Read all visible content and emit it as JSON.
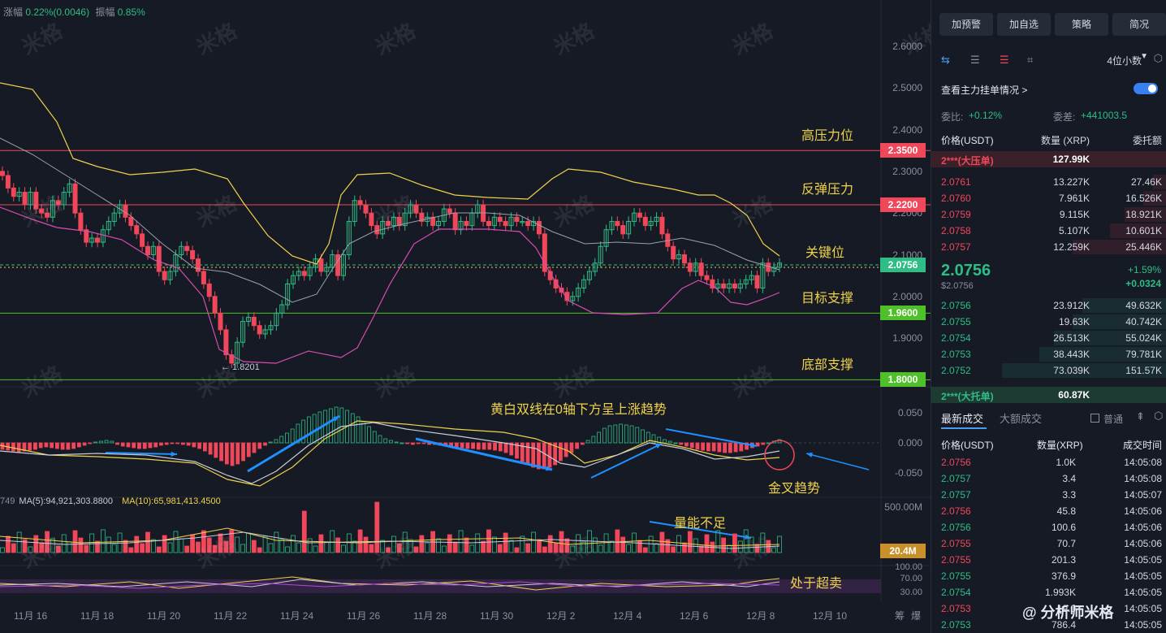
{
  "header": {
    "change_label": "涨幅",
    "change_value": "0.22%(0.0046)",
    "amp_label": "振幅",
    "amp_value": "0.85%"
  },
  "watermark": "米格",
  "price_axis": [
    "2.6000",
    "2.5000",
    "2.4000",
    "2.3000",
    "2.2000",
    "2.1000",
    "2.0000",
    "1.9000",
    "1.8000"
  ],
  "macd_axis": [
    "0.050",
    "0.000",
    "-0.050"
  ],
  "vol_axis": [
    "500.00M"
  ],
  "rsi_axis": [
    "100.00",
    "70.00",
    "30.00"
  ],
  "x_axis": [
    "11月 16",
    "11月 18",
    "11月 20",
    "11月 22",
    "11月 24",
    "11月 26",
    "11月 28",
    "11月 30",
    "12月 2",
    "12月 4",
    "12月 6",
    "12月 8",
    "12月 10"
  ],
  "x_extra": [
    "筹",
    "爆"
  ],
  "levels": [
    {
      "label": "高压力位",
      "price": "2.3500",
      "color": "#f0475a"
    },
    {
      "label": "反弹压力",
      "price": "2.2200",
      "color": "#f0475a"
    },
    {
      "label": "关键位",
      "price": "2.0756",
      "color": "#2ebd85"
    },
    {
      "label": "目标支撑",
      "price": "1.9600",
      "color": "#4fbf2a"
    },
    {
      "label": "底部支撑",
      "price": "1.8000",
      "color": "#4fbf2a"
    }
  ],
  "low_marker": "← 1.8201",
  "annotations": {
    "macd_title": "黄白双线在0轴下方呈上涨趋势",
    "golden_cross": "金叉趋势",
    "volume": "量能不足",
    "oversold": "处于超卖"
  },
  "ma_line": {
    "prefix": "749",
    "ma5": "MA(5):94,921,303.8800",
    "ma10": "MA(10):65,981,413.4500"
  },
  "vol_tag": "20.4M",
  "side": {
    "buttons": [
      "加预警",
      "加自选",
      "策略",
      "简况"
    ],
    "decimals": "4位小数",
    "main_order": "查看主力挂单情况 >",
    "ratio_label": "委比:",
    "ratio_value": "+0.12%",
    "diff_label": "委差:",
    "diff_value": "+441003.5",
    "cols": [
      "价格(USDT)",
      "数量 (XRP)",
      "委托额"
    ],
    "big_ask": {
      "label": "2***(大压单)",
      "qty": "127.99K"
    },
    "asks": [
      [
        "2.0761",
        "13.227K",
        "27.46K"
      ],
      [
        "2.0760",
        "7.961K",
        "16.526K"
      ],
      [
        "2.0759",
        "9.115K",
        "18.921K"
      ],
      [
        "2.0758",
        "5.107K",
        "10.601K"
      ],
      [
        "2.0757",
        "12.259K",
        "25.446K"
      ]
    ],
    "last_price": "2.0756",
    "last_usd": "$2.0756",
    "pct": "+1.59%",
    "chg": "+0.0324",
    "bids": [
      [
        "2.0756",
        "23.912K",
        "49.632K"
      ],
      [
        "2.0755",
        "19.63K",
        "40.742K"
      ],
      [
        "2.0754",
        "26.513K",
        "55.024K"
      ],
      [
        "2.0753",
        "38.443K",
        "79.781K"
      ],
      [
        "2.0752",
        "73.039K",
        "151.57K"
      ]
    ],
    "big_bid": {
      "label": "2***(大托单)",
      "qty": "60.87K"
    },
    "trade_tabs": [
      "最新成交",
      "大额成交"
    ],
    "normal": "普通",
    "trade_cols": [
      "价格(USDT)",
      "数量(XRP)",
      "成交时间"
    ],
    "trades": [
      [
        "2.0756",
        "1.0K",
        "14:05:08",
        "r"
      ],
      [
        "2.0757",
        "3.4",
        "14:05:08",
        "g"
      ],
      [
        "2.0757",
        "3.3",
        "14:05:07",
        "g"
      ],
      [
        "2.0756",
        "45.8",
        "14:05:06",
        "r"
      ],
      [
        "2.0756",
        "100.6",
        "14:05:06",
        "g"
      ],
      [
        "2.0755",
        "70.7",
        "14:05:06",
        "r"
      ],
      [
        "2.0755",
        "201.3",
        "14:05:05",
        "r"
      ],
      [
        "2.0755",
        "376.9",
        "14:05:05",
        "g"
      ],
      [
        "2.0754",
        "1.993K",
        "14:05:05",
        "g"
      ],
      [
        "2.0753",
        "19.0",
        "14:05:05",
        "r"
      ],
      [
        "2.0753",
        "786.4",
        "14:05:05",
        "g"
      ]
    ],
    "brand": "@ 分析师米格"
  }
}
